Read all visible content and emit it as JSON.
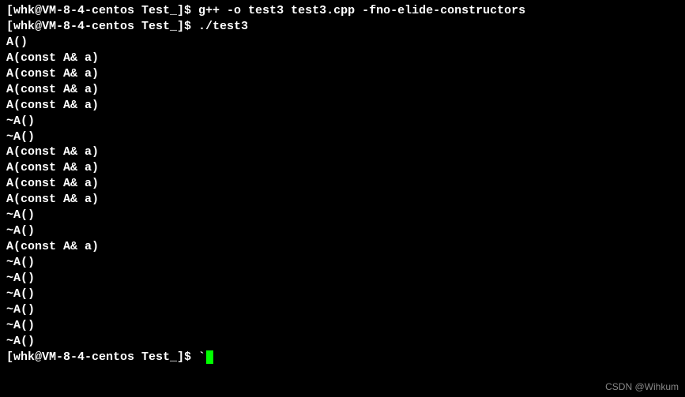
{
  "lines": {
    "line1": {
      "prompt": "[whk@VM-8-4-centos Test_]$ ",
      "command": "g++ -o test3 test3.cpp -fno-elide-constructors"
    },
    "line2": {
      "prompt": "[whk@VM-8-4-centos Test_]$ ",
      "command": "./test3"
    },
    "out3": "A()",
    "out4": "A(const A& a)",
    "out5": "A(const A& a)",
    "out6": "A(const A& a)",
    "out7": "A(const A& a)",
    "out8": "~A()",
    "out9": "~A()",
    "out10": "A(const A& a)",
    "out11": "A(const A& a)",
    "out12": "A(const A& a)",
    "out13": "A(const A& a)",
    "out14": "~A()",
    "out15": "~A()",
    "out16": "A(const A& a)",
    "out17": "~A()",
    "out18": "~A()",
    "out19": "~A()",
    "out20": "~A()",
    "out21": "~A()",
    "out22": "~A()",
    "line23": {
      "prompt": "[whk@VM-8-4-centos Test_]$ ",
      "typed": "`"
    }
  },
  "watermark": "CSDN @Wihkum"
}
